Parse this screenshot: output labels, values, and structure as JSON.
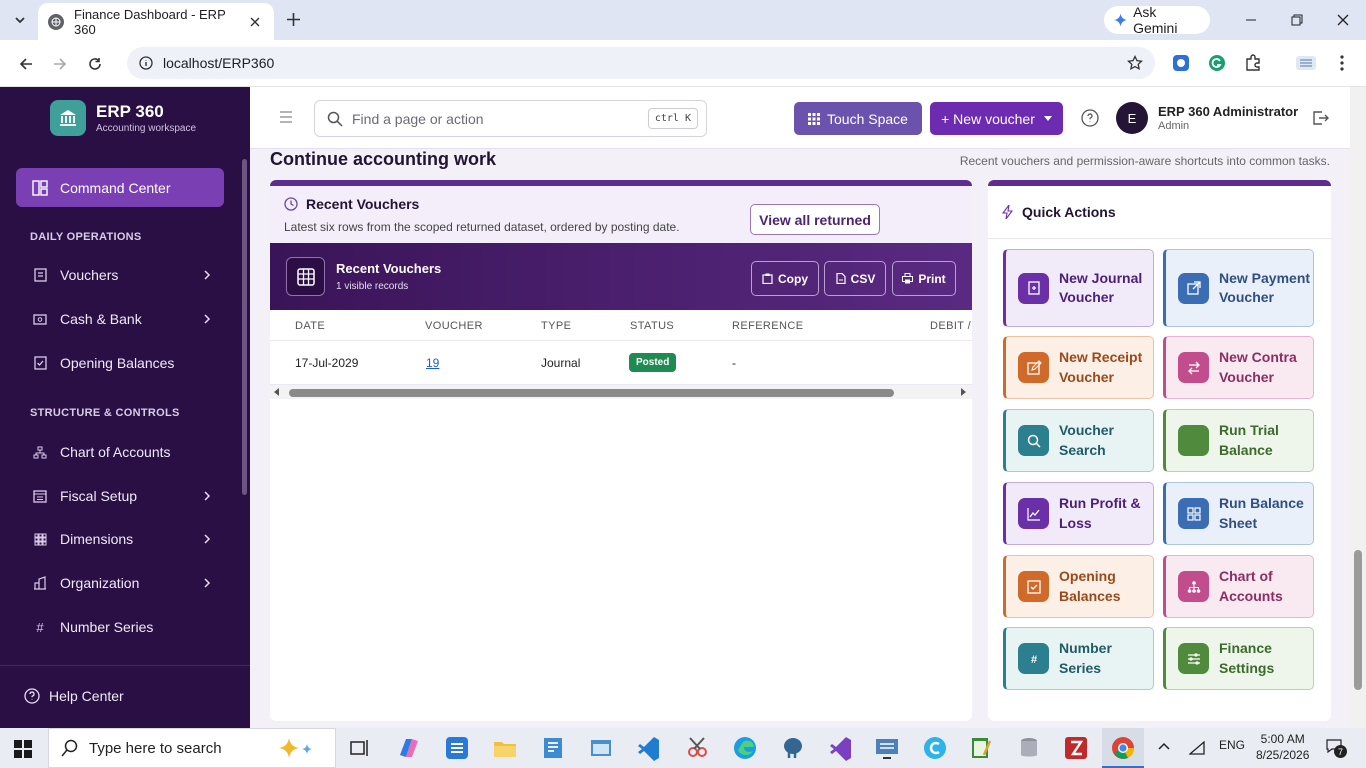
{
  "browser": {
    "tab_title": "Finance Dashboard - ERP 360",
    "gemini_label": "Ask Gemini",
    "url": "localhost/ERP360"
  },
  "sidebar": {
    "brand_name": "ERP 360",
    "brand_sub": "Accounting workspace",
    "active_item": "Command Center",
    "section_daily": "DAILY OPERATIONS",
    "daily_items": [
      {
        "label": "Vouchers",
        "icon": "receipt-icon",
        "has_children": true
      },
      {
        "label": "Cash & Bank",
        "icon": "cash-icon",
        "has_children": true
      },
      {
        "label": "Opening Balances",
        "icon": "checklist-icon",
        "has_children": false
      }
    ],
    "section_structure": "STRUCTURE & CONTROLS",
    "structure_items": [
      {
        "label": "Chart of Accounts",
        "icon": "hierarchy-icon",
        "has_children": false
      },
      {
        "label": "Fiscal Setup",
        "icon": "calendar-icon",
        "has_children": true
      },
      {
        "label": "Dimensions",
        "icon": "grid-icon",
        "has_children": true
      },
      {
        "label": "Organization",
        "icon": "building-icon",
        "has_children": true
      },
      {
        "label": "Number Series",
        "icon": "hash-icon",
        "has_children": false
      }
    ],
    "help_label": "Help Center"
  },
  "topbar": {
    "search_placeholder": "Find a page or action",
    "search_shortcut": "ctrl K",
    "touch_label": "Touch Space",
    "new_voucher_label": "+ New voucher",
    "user_initial": "E",
    "user_name": "ERP 360 Administrator",
    "user_role": "Admin"
  },
  "page": {
    "title": "Continue accounting work",
    "subtitle": "Recent vouchers and permission-aware shortcuts into common tasks."
  },
  "recent_vouchers": {
    "title": "Recent Vouchers",
    "subtitle": "Latest six rows from the scoped returned dataset, ordered by posting date.",
    "view_all_label": "View all returned",
    "band_title": "Recent Vouchers",
    "band_count": "1 visible records",
    "copy_label": "Copy",
    "csv_label": "CSV",
    "print_label": "Print",
    "columns": [
      "DATE",
      "VOUCHER",
      "TYPE",
      "STATUS",
      "REFERENCE",
      "DEBIT /"
    ],
    "rows": [
      {
        "date": "17-Jul-2029",
        "voucher": "19",
        "type": "Journal",
        "status": "Posted",
        "reference": "-"
      }
    ]
  },
  "quick_actions": {
    "title": "Quick Actions",
    "items": [
      {
        "label": "New Journal Voucher",
        "icon": "journal-icon",
        "color": "#6b2fa8",
        "bg": "#f1eaf8",
        "text": "#4b1f7a"
      },
      {
        "label": "New Payment Voucher",
        "icon": "external-link-icon",
        "color": "#3b6db5",
        "bg": "#eaf0f9",
        "text": "#2f4f82"
      },
      {
        "label": "New Receipt Voucher",
        "icon": "edit-icon",
        "color": "#d06a2b",
        "bg": "#fbefe6",
        "text": "#9a4a1a"
      },
      {
        "label": "New Contra Voucher",
        "icon": "swap-icon",
        "color": "#c24d8c",
        "bg": "#f9eaf2",
        "text": "#8c2e62"
      },
      {
        "label": "Voucher Search",
        "icon": "search-icon",
        "color": "#2b7f8e",
        "bg": "#e8f3f4",
        "text": "#1f5c68"
      },
      {
        "label": "Run Trial Balance",
        "icon": "scale-icon",
        "color": "#4f8a3d",
        "bg": "#eef5ea",
        "text": "#3c6a2d"
      },
      {
        "label": "Run Profit & Loss",
        "icon": "chart-line-icon",
        "color": "#6b2fa8",
        "bg": "#f1eaf8",
        "text": "#4b1f7a"
      },
      {
        "label": "Run Balance Sheet",
        "icon": "dashboard-icon",
        "color": "#3b6db5",
        "bg": "#eaf0f9",
        "text": "#2f4f82"
      },
      {
        "label": "Opening Balances",
        "icon": "checklist-icon",
        "color": "#d06a2b",
        "bg": "#fbefe6",
        "text": "#9a4a1a"
      },
      {
        "label": "Chart of Accounts",
        "icon": "hierarchy-icon",
        "color": "#c24d8c",
        "bg": "#f9eaf2",
        "text": "#8c2e62"
      },
      {
        "label": "Number Series",
        "icon": "hash-icon",
        "color": "#2b7f8e",
        "bg": "#e8f3f4",
        "text": "#1f5c68"
      },
      {
        "label": "Finance Settings",
        "icon": "sliders-icon",
        "color": "#4f8a3d",
        "bg": "#eef5ea",
        "text": "#3c6a2d"
      }
    ]
  },
  "taskbar": {
    "search_placeholder": "Type here to search",
    "lang": "ENG",
    "time": "5:00 AM",
    "date": "8/25/2026",
    "notifications": "7"
  }
}
